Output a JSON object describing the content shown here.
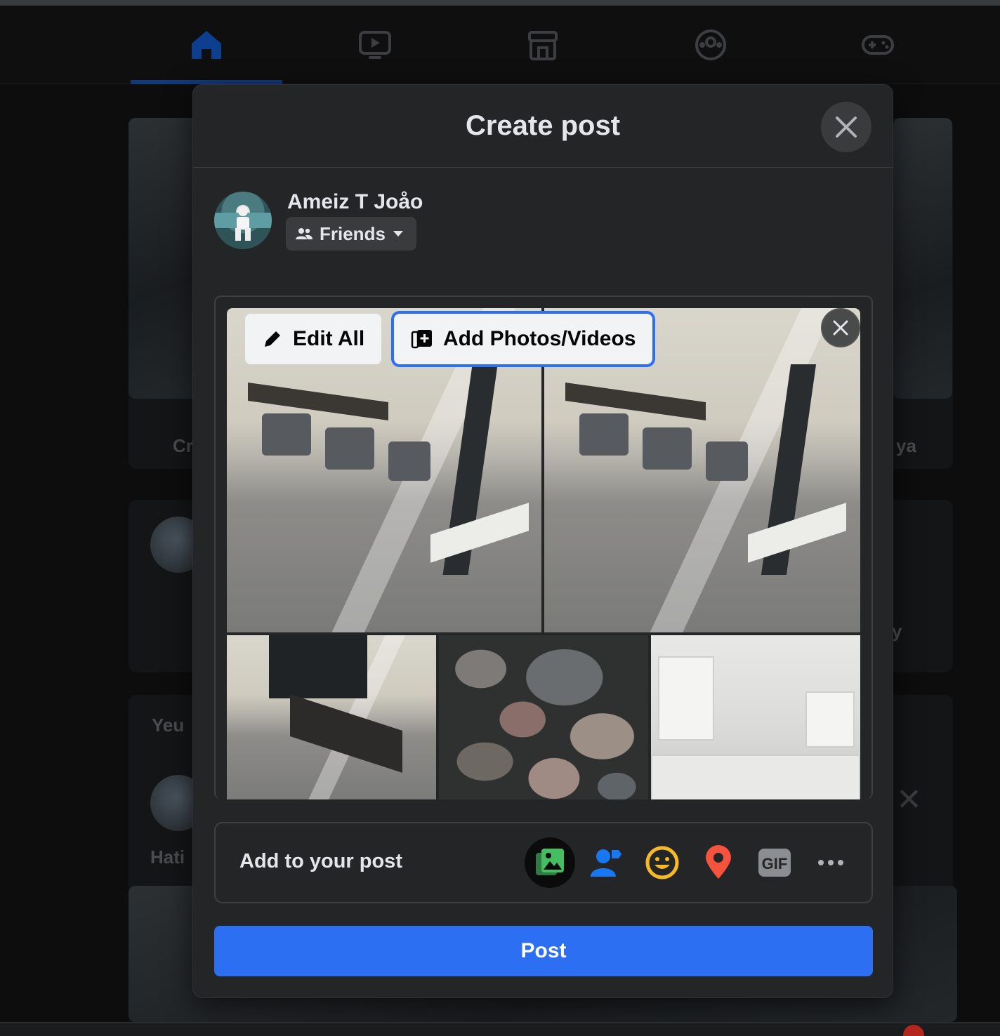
{
  "modal": {
    "title": "Create post",
    "user_name": "Ameiz T Joåo",
    "audience": "Friends",
    "edit_all_label": "Edit All",
    "add_media_label": "Add Photos/Videos",
    "add_to_post_label": "Add to your post",
    "post_label": "Post"
  },
  "nav": {
    "items": [
      "home-icon",
      "watch-icon",
      "marketplace-icon",
      "groups-icon",
      "gaming-icon"
    ],
    "active": "home-icon"
  },
  "background": {
    "partial_texts": [
      "Cr",
      "ya",
      "y",
      "Yeu",
      "Hati"
    ]
  },
  "media": {
    "tiles": [
      "kitchen-photo",
      "kitchen-photo",
      "dining-photo",
      "stones-photo",
      "white-kitchen-photo"
    ]
  },
  "add_icons": [
    "photo-video-icon",
    "tag-people-icon",
    "feeling-icon",
    "check-in-icon",
    "gif-icon",
    "more-icon"
  ],
  "colors": {
    "accent": "#2d6ff2",
    "photo_green": "#45bd62",
    "tag_blue": "#1877f2",
    "feeling_yellow": "#f7b928",
    "checkin_red": "#f5533d",
    "gif_gray": "#8a8d91"
  }
}
